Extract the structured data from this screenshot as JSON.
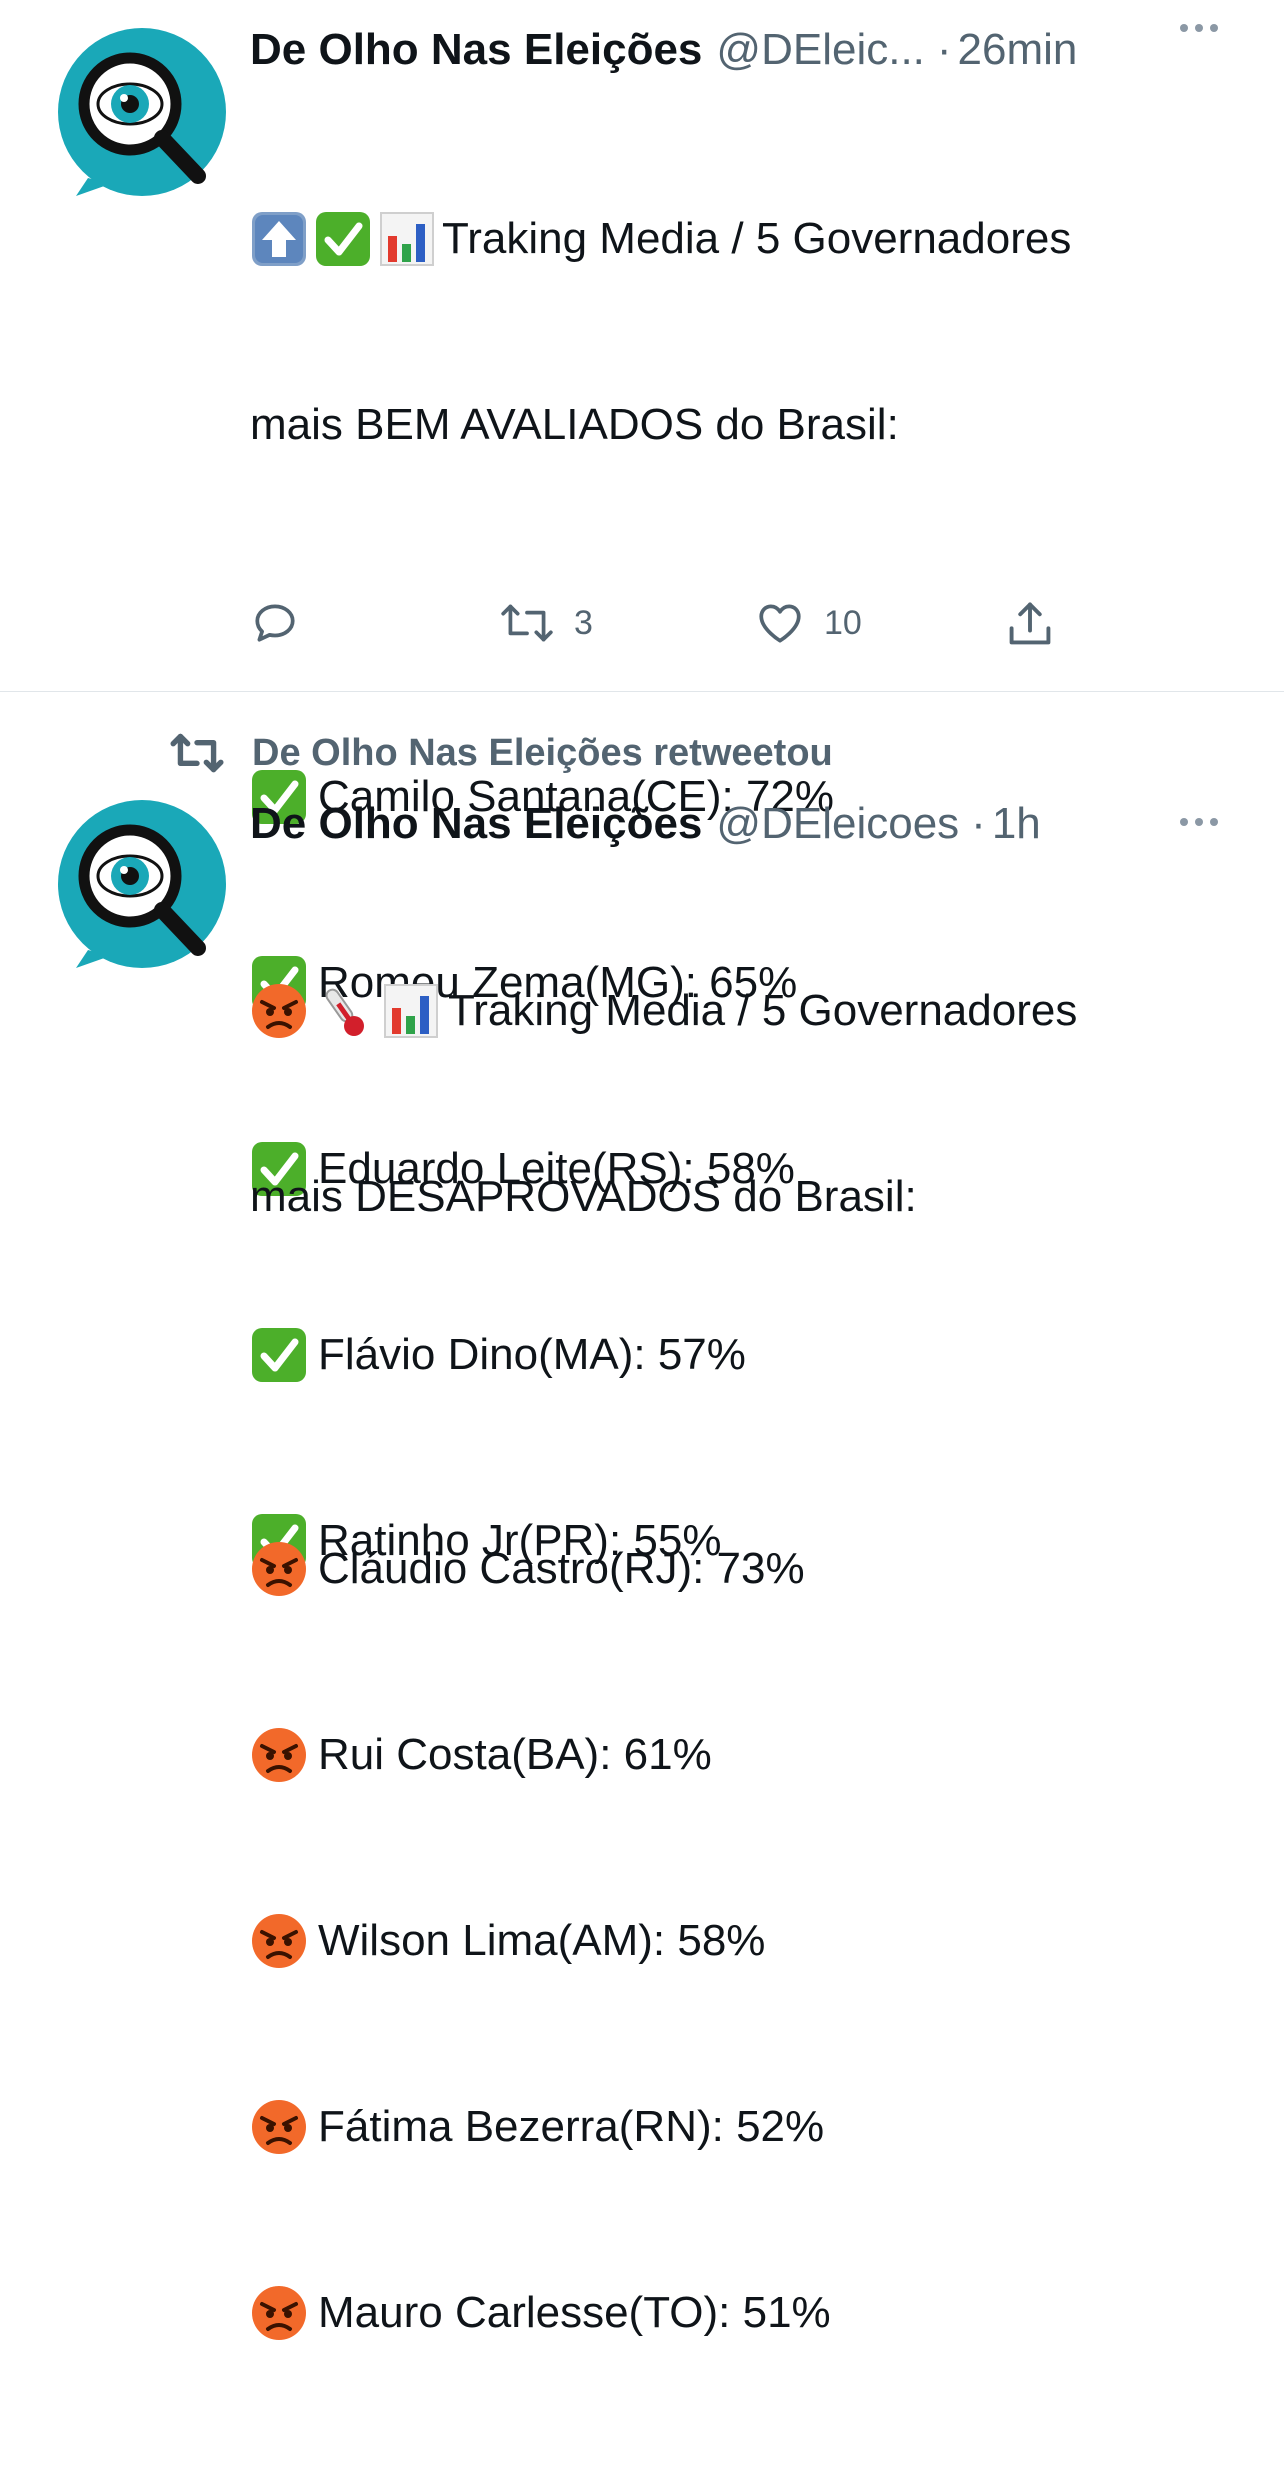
{
  "tweets": [
    {
      "name": "De Olho Nas Eleições",
      "handle": "@DEleic...",
      "dot": "·",
      "time": "26min",
      "heading_line1": "Traking Media / 5 Governadores",
      "heading_line2": "mais BEM AVALIADOS do Brasil:",
      "heading_emojis": [
        "up-arrow-emoji",
        "check-mark-emoji",
        "bar-chart-emoji"
      ],
      "items": [
        {
          "text": "Camilo Santana(CE): 72%",
          "emoji": "check-mark-emoji"
        },
        {
          "text": "Romeu Zema(MG): 65%",
          "emoji": "check-mark-emoji"
        },
        {
          "text": "Eduardo Leite(RS): 58%",
          "emoji": "check-mark-emoji"
        },
        {
          "text": "Flávio Dino(MA): 57%",
          "emoji": "check-mark-emoji"
        },
        {
          "text": "Ratinho Jr(PR): 55%",
          "emoji": "check-mark-emoji"
        }
      ],
      "actions": {
        "reply_count": "",
        "retweet_count": "3",
        "like_count": "10"
      }
    },
    {
      "retweet_label": "De Olho Nas Eleições retweetou",
      "name": "De Olho Nas Eleições",
      "handle": "@DEleicoes",
      "dot": "·",
      "time": "1h",
      "heading_line1": "Traking Media / 5 Governadores",
      "heading_line2": "mais DESAPROVADOS do Brasil:",
      "heading_emojis": [
        "angry-face-emoji",
        "thermometer-emoji",
        "bar-chart-emoji"
      ],
      "items": [
        {
          "text": "Cláudio Castro(RJ): 73%",
          "emoji": "angry-face-emoji"
        },
        {
          "text": "Rui Costa(BA): 61%",
          "emoji": "angry-face-emoji"
        },
        {
          "text": "Wilson Lima(AM): 58%",
          "emoji": "angry-face-emoji"
        },
        {
          "text": "Fátima Bezerra(RN): 52%",
          "emoji": "angry-face-emoji"
        },
        {
          "text": "Mauro Carlesse(TO): 51%",
          "emoji": "angry-face-emoji"
        }
      ]
    }
  ],
  "colors": {
    "avatar_teal": "#1aa8b8",
    "check_green": "#4caf2a",
    "angry_orange": "#f2692a",
    "icon_gray": "#536471"
  }
}
